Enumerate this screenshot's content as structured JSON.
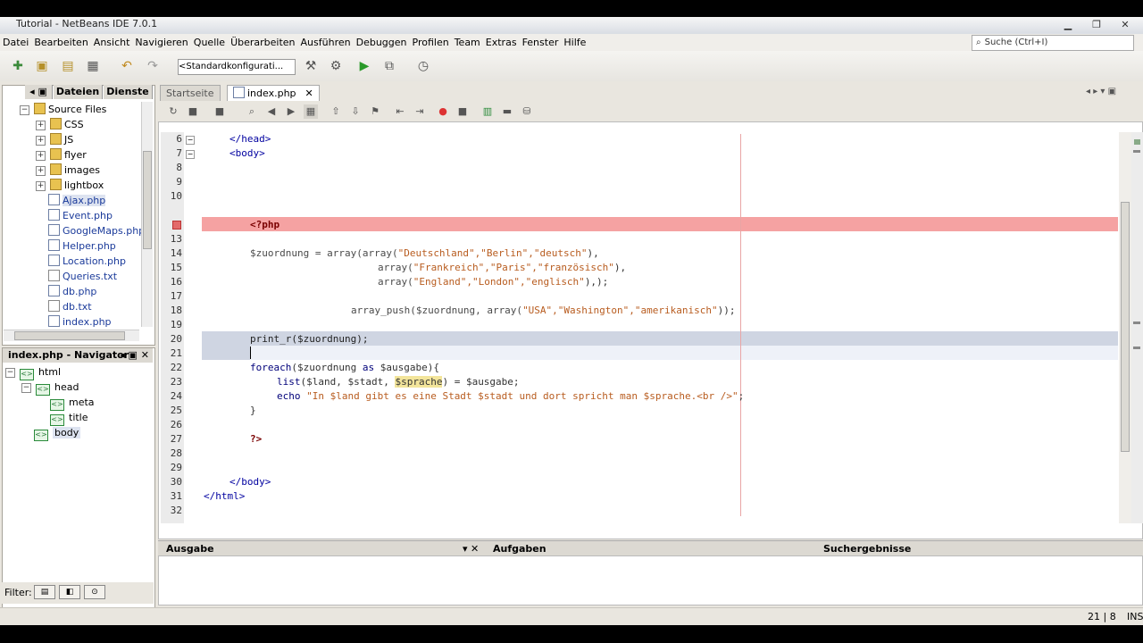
{
  "window": {
    "title": "Tutorial - NetBeans IDE 7.0.1"
  },
  "menu": [
    "Datei",
    "Bearbeiten",
    "Ansicht",
    "Navigieren",
    "Quelle",
    "Überarbeiten",
    "Ausführen",
    "Debuggen",
    "Profilen",
    "Team",
    "Extras",
    "Fenster",
    "Hilfe"
  ],
  "search": {
    "placeholder": "Suche (Ctrl+I)"
  },
  "toolbar": {
    "config": "<Standardkonfigurati..."
  },
  "left_panel": {
    "tabs": [
      "Dateien",
      "Dienste"
    ],
    "tree_root": "Source Files",
    "folders": [
      "CSS",
      "JS",
      "flyer",
      "images",
      "lightbox"
    ],
    "files": [
      "Ajax.php",
      "Event.php",
      "GoogleMaps.php",
      "Helper.php",
      "Location.php",
      "Queries.txt",
      "db.php",
      "db.txt",
      "index.php"
    ]
  },
  "navigator": {
    "title": "index.php - Navigator",
    "items": [
      "html",
      "head",
      "meta",
      "title",
      "body"
    ],
    "filter_label": "Filter:"
  },
  "editor": {
    "tabs": [
      "Startseite",
      "index.php"
    ],
    "line_numbers": [
      "6",
      "7",
      "8",
      "9",
      "10",
      "",
      "13",
      "14",
      "15",
      "16",
      "17",
      "18",
      "19",
      "20",
      "21",
      "22",
      "23",
      "24",
      "25",
      "26",
      "27",
      "28",
      "29",
      "30",
      "31",
      "32"
    ],
    "lines": {
      "l6": "</head>",
      "l7": "<body>",
      "bp": "<?php",
      "l14a": "$zuordnung = array(array(",
      "l14b": "\"Deutschland\",\"Berlin\",\"deutsch\"",
      "l14c": "),",
      "l15a": "array(",
      "l15b": "\"Frankreich\",\"Paris\",\"französisch\"",
      "l15c": "),",
      "l16a": "array(",
      "l16b": "\"England\",\"London\",\"englisch\"",
      "l16c": "),);",
      "l18a": "array_push($zuordnung, array(",
      "l18b": "\"USA\",\"Washington\",\"amerikanisch\"",
      "l18c": "));",
      "l20": "print_r($zuordnung);",
      "l22a": "foreach",
      "l22b": "($zuordnung ",
      "l22c": "as",
      "l22d": " $ausgabe){",
      "l23a": "list",
      "l23b": "($land, $stadt, ",
      "l23c": "$sprache",
      "l23d": ") = $ausgabe;",
      "l24a": "echo",
      "l24b": "\"In $land gibt es eine Stadt $stadt und dort spricht man $sprache.<br />\"",
      "l24c": ";",
      "l25": "}",
      "l27": "?>",
      "l30": "</body>",
      "l31": "</html>"
    }
  },
  "output": {
    "tabs": [
      "Ausgabe",
      "Aufgaben",
      "Suchergebnisse"
    ]
  },
  "status": {
    "position": "21 | 8",
    "mode": "INS"
  },
  "colors": {
    "breakpoint_row": "#f5a2a2",
    "selection": "#cfd5e2",
    "string": "#b85c1f",
    "keyword": "#00007a"
  }
}
